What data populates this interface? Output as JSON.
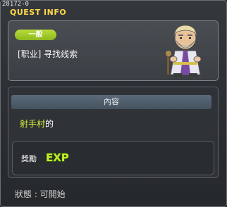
{
  "window": {
    "quest_id": "28172-0",
    "title": "QUEST INFO"
  },
  "quest": {
    "badge": "一般",
    "category": "[职业] 寻找线索",
    "npc_icon": "old-sage-npc-icon"
  },
  "content": {
    "section_title": "內容",
    "highlight": "射手村",
    "text_suffix": "的"
  },
  "reward": {
    "label": "獎勵",
    "icon": "exp-icon",
    "icon_text": "EXP"
  },
  "status": {
    "text": "狀態 : 可開始"
  },
  "colors": {
    "title": "#ffd94a",
    "badge": "#9fcc24",
    "highlight": "#d8f03c"
  }
}
